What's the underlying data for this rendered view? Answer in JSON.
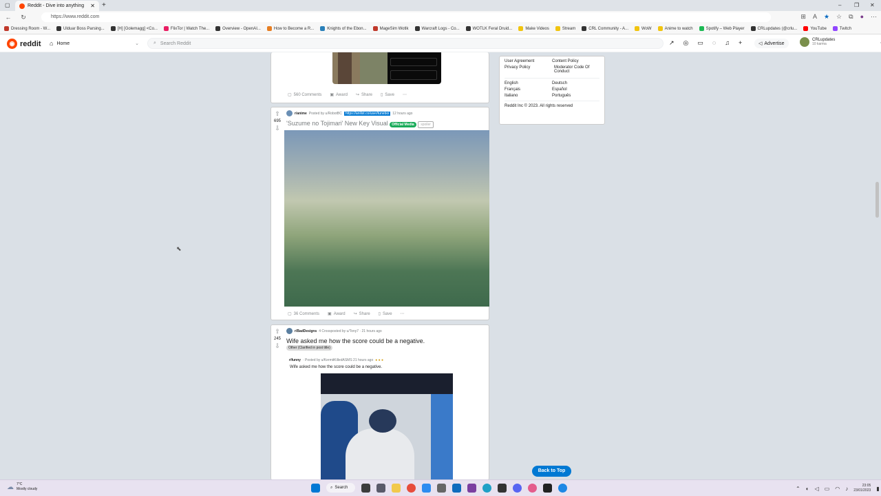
{
  "browser": {
    "tab_title": "Reddit - Dive into anything",
    "url": "https://www.reddit.com",
    "bookmarks": [
      {
        "label": "Dressing Room - W...",
        "color": "#c0392b"
      },
      {
        "label": "Ulduar Boss Parsing...",
        "color": "#333333"
      },
      {
        "label": "[H] [Golemagg] <Co...",
        "color": "#333333"
      },
      {
        "label": "FlixTor | Watch The...",
        "color": "#e91e63"
      },
      {
        "label": "Overview - OpenAI...",
        "color": "#333333"
      },
      {
        "label": "How to Become a R...",
        "color": "#e67e22"
      },
      {
        "label": "Knights of the Ebon...",
        "color": "#2980b9"
      },
      {
        "label": "MageSim Wotlk",
        "color": "#c0392b"
      },
      {
        "label": "Warcraft Logs - Co...",
        "color": "#333333"
      },
      {
        "label": "WOTLK Feral Druid...",
        "color": "#333333"
      },
      {
        "label": "Make Videos",
        "color": "#f1c40f"
      },
      {
        "label": "Stream",
        "color": "#f1c40f"
      },
      {
        "label": "CRL Community - A...",
        "color": "#333333"
      },
      {
        "label": "WoW",
        "color": "#f1c40f"
      },
      {
        "label": "Anime to watch",
        "color": "#f1c40f"
      },
      {
        "label": "Spotify – Web Player",
        "color": "#1db954"
      },
      {
        "label": "CRLupdates (@crlu...",
        "color": "#333333"
      },
      {
        "label": "YouTube",
        "color": "#ff0000"
      },
      {
        "label": "Twitch",
        "color": "#9146ff"
      }
    ]
  },
  "header": {
    "wordmark": "reddit",
    "home_label": "Home",
    "search_placeholder": "Search Reddit",
    "advertise_label": "Advertise",
    "username": "CRLupdates",
    "karma": "10 karma"
  },
  "posts": [
    {
      "comments": "560 Comments",
      "award": "Award",
      "share": "Share",
      "save": "Save"
    },
    {
      "votes": "695",
      "subreddit": "r/anime",
      "posted_by": "Posted by u/RobotBC",
      "flair_link": "https://anilist.co/user/tuneboi",
      "time": "12 hours ago",
      "title": "'Suzume no Tojimari' New Key Visual",
      "flair": "Official Media",
      "spoiler": "spoiler",
      "comments": "36 Comments",
      "award": "Award",
      "share": "Share",
      "save": "Save"
    },
    {
      "votes": "245",
      "subreddit": "r/BadDesigns",
      "crossposted": "4 Crossposted by u/Tony7 · 21 hours ago",
      "title": "Wife asked me how the score could be a negative.",
      "flair": "Other (Clarified in post title)",
      "xpost_sub": "r/funny",
      "xpost_by": "· Posted by u/KermitKilledASMS 21 hours ago",
      "xpost_title": "Wife asked me how the score could be a negative."
    }
  ],
  "sidebar": {
    "links": [
      [
        "User Agreement",
        "Content Policy"
      ],
      [
        "Privacy Policy",
        "Moderator Code Of Conduct"
      ]
    ],
    "languages": [
      [
        "English",
        "Deutsch"
      ],
      [
        "Français",
        "Español"
      ],
      [
        "Italiano",
        "Português"
      ]
    ],
    "copyright": "Reddit Inc © 2023. All rights reserved"
  },
  "back_to_top": "Back to Top",
  "taskbar": {
    "temp": "7°C",
    "weather": "Mostly cloudy",
    "search": "Search",
    "time": "23:05",
    "date": "23/01/2023"
  }
}
